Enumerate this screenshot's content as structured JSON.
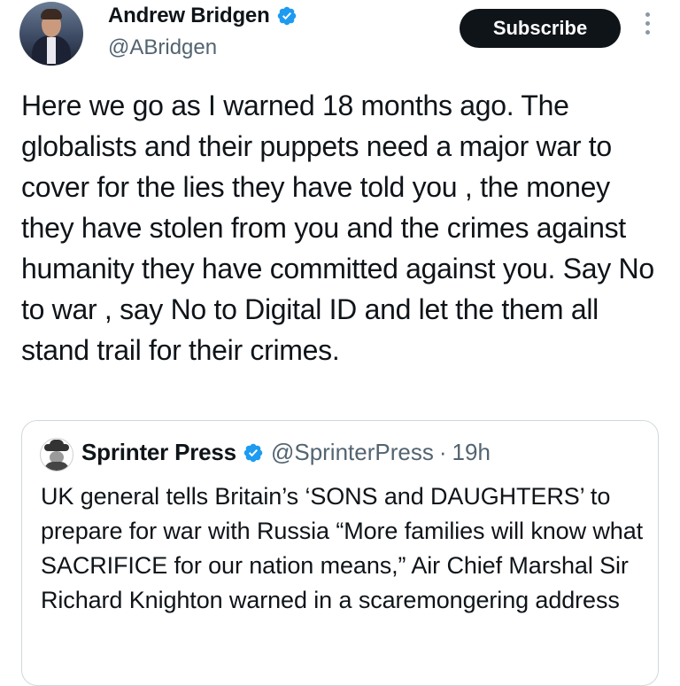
{
  "author": {
    "display_name": "Andrew Bridgen",
    "handle": "@ABridgen",
    "verified_color": "#1d9bf0"
  },
  "actions": {
    "subscribe_label": "Subscribe",
    "more_icon": "more-vertical-icon"
  },
  "tweet": {
    "text": "Here we go as I warned 18 months ago. The globalists and their puppets need a major war to cover for the lies they have told you , the money they have stolen from you and the crimes against humanity they have committed against you. Say No to war , say No to Digital ID and let the them all stand trail for their crimes."
  },
  "quoted_tweet": {
    "display_name": "Sprinter Press",
    "handle": "@SprinterPress",
    "separator": "·",
    "time": "19h",
    "text": "UK general tells Britain’s ‘SONS and DAUGHTERS’ to prepare for war with Russia “More families will know what SACRIFICE for our nation means,” Air Chief Marshal Sir Richard Knighton warned in a scaremongering address"
  },
  "colors": {
    "text": "#0f1419",
    "secondary": "#536471",
    "button_bg": "#0f1419",
    "border": "#cfd9de"
  }
}
